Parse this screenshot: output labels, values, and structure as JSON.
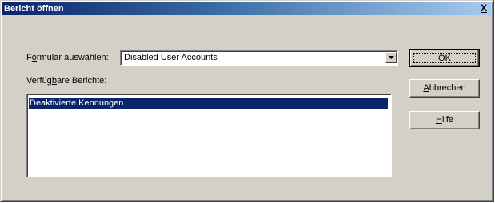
{
  "window": {
    "title": "Bericht öffnen",
    "close_label": "X"
  },
  "form": {
    "formular_label_pre": "F",
    "formular_label_mnemonic": "o",
    "formular_label_post": "rmular auswählen:",
    "formular_selected": "Disabled User Accounts",
    "berichte_label_pre": "Verfüg",
    "berichte_label_mnemonic": "b",
    "berichte_label_post": "are Berichte:"
  },
  "reports": {
    "items": [
      {
        "label": "Deaktivierte Kennungen",
        "selected": true
      }
    ]
  },
  "buttons": {
    "ok_mnemonic": "O",
    "ok_rest": "K",
    "cancel_mnemonic": "A",
    "cancel_rest": "bbrechen",
    "help_mnemonic": "H",
    "help_rest": "ilfe"
  },
  "colors": {
    "titlebar_start": "#0a246a",
    "titlebar_end": "#a6caf0",
    "selection": "#0a246a",
    "face": "#d4d0c8"
  },
  "icons": {
    "combo_arrow": "triangle-down-icon"
  }
}
